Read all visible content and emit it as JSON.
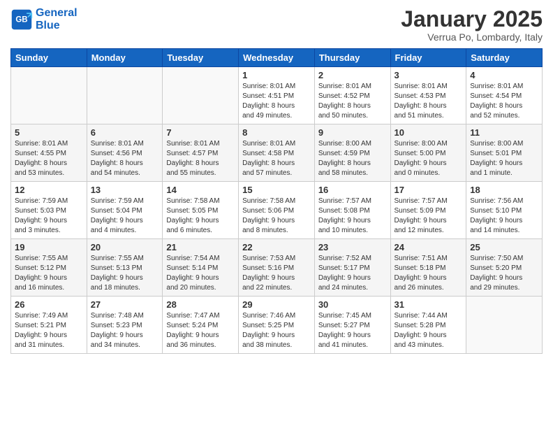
{
  "logo": {
    "line1": "General",
    "line2": "Blue"
  },
  "title": "January 2025",
  "subtitle": "Verrua Po, Lombardy, Italy",
  "headers": [
    "Sunday",
    "Monday",
    "Tuesday",
    "Wednesday",
    "Thursday",
    "Friday",
    "Saturday"
  ],
  "weeks": [
    [
      {
        "day": "",
        "info": ""
      },
      {
        "day": "",
        "info": ""
      },
      {
        "day": "",
        "info": ""
      },
      {
        "day": "1",
        "info": "Sunrise: 8:01 AM\nSunset: 4:51 PM\nDaylight: 8 hours\nand 49 minutes."
      },
      {
        "day": "2",
        "info": "Sunrise: 8:01 AM\nSunset: 4:52 PM\nDaylight: 8 hours\nand 50 minutes."
      },
      {
        "day": "3",
        "info": "Sunrise: 8:01 AM\nSunset: 4:53 PM\nDaylight: 8 hours\nand 51 minutes."
      },
      {
        "day": "4",
        "info": "Sunrise: 8:01 AM\nSunset: 4:54 PM\nDaylight: 8 hours\nand 52 minutes."
      }
    ],
    [
      {
        "day": "5",
        "info": "Sunrise: 8:01 AM\nSunset: 4:55 PM\nDaylight: 8 hours\nand 53 minutes."
      },
      {
        "day": "6",
        "info": "Sunrise: 8:01 AM\nSunset: 4:56 PM\nDaylight: 8 hours\nand 54 minutes."
      },
      {
        "day": "7",
        "info": "Sunrise: 8:01 AM\nSunset: 4:57 PM\nDaylight: 8 hours\nand 55 minutes."
      },
      {
        "day": "8",
        "info": "Sunrise: 8:01 AM\nSunset: 4:58 PM\nDaylight: 8 hours\nand 57 minutes."
      },
      {
        "day": "9",
        "info": "Sunrise: 8:00 AM\nSunset: 4:59 PM\nDaylight: 8 hours\nand 58 minutes."
      },
      {
        "day": "10",
        "info": "Sunrise: 8:00 AM\nSunset: 5:00 PM\nDaylight: 9 hours\nand 0 minutes."
      },
      {
        "day": "11",
        "info": "Sunrise: 8:00 AM\nSunset: 5:01 PM\nDaylight: 9 hours\nand 1 minute."
      }
    ],
    [
      {
        "day": "12",
        "info": "Sunrise: 7:59 AM\nSunset: 5:03 PM\nDaylight: 9 hours\nand 3 minutes."
      },
      {
        "day": "13",
        "info": "Sunrise: 7:59 AM\nSunset: 5:04 PM\nDaylight: 9 hours\nand 4 minutes."
      },
      {
        "day": "14",
        "info": "Sunrise: 7:58 AM\nSunset: 5:05 PM\nDaylight: 9 hours\nand 6 minutes."
      },
      {
        "day": "15",
        "info": "Sunrise: 7:58 AM\nSunset: 5:06 PM\nDaylight: 9 hours\nand 8 minutes."
      },
      {
        "day": "16",
        "info": "Sunrise: 7:57 AM\nSunset: 5:08 PM\nDaylight: 9 hours\nand 10 minutes."
      },
      {
        "day": "17",
        "info": "Sunrise: 7:57 AM\nSunset: 5:09 PM\nDaylight: 9 hours\nand 12 minutes."
      },
      {
        "day": "18",
        "info": "Sunrise: 7:56 AM\nSunset: 5:10 PM\nDaylight: 9 hours\nand 14 minutes."
      }
    ],
    [
      {
        "day": "19",
        "info": "Sunrise: 7:55 AM\nSunset: 5:12 PM\nDaylight: 9 hours\nand 16 minutes."
      },
      {
        "day": "20",
        "info": "Sunrise: 7:55 AM\nSunset: 5:13 PM\nDaylight: 9 hours\nand 18 minutes."
      },
      {
        "day": "21",
        "info": "Sunrise: 7:54 AM\nSunset: 5:14 PM\nDaylight: 9 hours\nand 20 minutes."
      },
      {
        "day": "22",
        "info": "Sunrise: 7:53 AM\nSunset: 5:16 PM\nDaylight: 9 hours\nand 22 minutes."
      },
      {
        "day": "23",
        "info": "Sunrise: 7:52 AM\nSunset: 5:17 PM\nDaylight: 9 hours\nand 24 minutes."
      },
      {
        "day": "24",
        "info": "Sunrise: 7:51 AM\nSunset: 5:18 PM\nDaylight: 9 hours\nand 26 minutes."
      },
      {
        "day": "25",
        "info": "Sunrise: 7:50 AM\nSunset: 5:20 PM\nDaylight: 9 hours\nand 29 minutes."
      }
    ],
    [
      {
        "day": "26",
        "info": "Sunrise: 7:49 AM\nSunset: 5:21 PM\nDaylight: 9 hours\nand 31 minutes."
      },
      {
        "day": "27",
        "info": "Sunrise: 7:48 AM\nSunset: 5:23 PM\nDaylight: 9 hours\nand 34 minutes."
      },
      {
        "day": "28",
        "info": "Sunrise: 7:47 AM\nSunset: 5:24 PM\nDaylight: 9 hours\nand 36 minutes."
      },
      {
        "day": "29",
        "info": "Sunrise: 7:46 AM\nSunset: 5:25 PM\nDaylight: 9 hours\nand 38 minutes."
      },
      {
        "day": "30",
        "info": "Sunrise: 7:45 AM\nSunset: 5:27 PM\nDaylight: 9 hours\nand 41 minutes."
      },
      {
        "day": "31",
        "info": "Sunrise: 7:44 AM\nSunset: 5:28 PM\nDaylight: 9 hours\nand 43 minutes."
      },
      {
        "day": "",
        "info": ""
      }
    ]
  ]
}
